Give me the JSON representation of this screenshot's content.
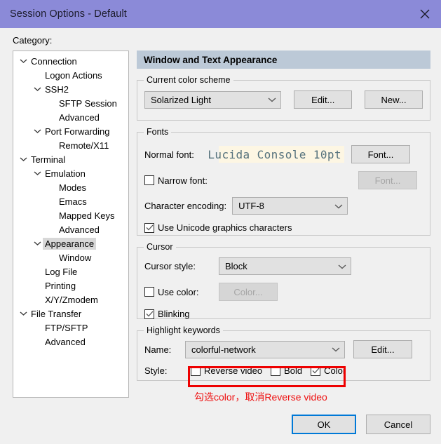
{
  "window": {
    "title": "Session Options - Default",
    "close_icon": "close-icon",
    "titlebar_color": "#8b8ad8"
  },
  "sidebar": {
    "label": "Category:",
    "items": [
      {
        "label": "Connection",
        "level": 0,
        "chevron": true,
        "selected": false
      },
      {
        "label": "Logon Actions",
        "level": 1,
        "chevron": false,
        "selected": false
      },
      {
        "label": "SSH2",
        "level": 1,
        "chevron": true,
        "selected": false
      },
      {
        "label": "SFTP Session",
        "level": 2,
        "chevron": false,
        "selected": false
      },
      {
        "label": "Advanced",
        "level": 2,
        "chevron": false,
        "selected": false
      },
      {
        "label": "Port Forwarding",
        "level": 1,
        "chevron": true,
        "selected": false
      },
      {
        "label": "Remote/X11",
        "level": 2,
        "chevron": false,
        "selected": false
      },
      {
        "label": "Terminal",
        "level": 0,
        "chevron": true,
        "selected": false
      },
      {
        "label": "Emulation",
        "level": 1,
        "chevron": true,
        "selected": false
      },
      {
        "label": "Modes",
        "level": 2,
        "chevron": false,
        "selected": false
      },
      {
        "label": "Emacs",
        "level": 2,
        "chevron": false,
        "selected": false
      },
      {
        "label": "Mapped Keys",
        "level": 2,
        "chevron": false,
        "selected": false
      },
      {
        "label": "Advanced",
        "level": 2,
        "chevron": false,
        "selected": false
      },
      {
        "label": "Appearance",
        "level": 1,
        "chevron": true,
        "selected": true
      },
      {
        "label": "Window",
        "level": 2,
        "chevron": false,
        "selected": false
      },
      {
        "label": "Log File",
        "level": 1,
        "chevron": false,
        "selected": false
      },
      {
        "label": "Printing",
        "level": 1,
        "chevron": false,
        "selected": false
      },
      {
        "label": "X/Y/Zmodem",
        "level": 1,
        "chevron": false,
        "selected": false
      },
      {
        "label": "File Transfer",
        "level": 0,
        "chevron": true,
        "selected": false
      },
      {
        "label": "FTP/SFTP",
        "level": 1,
        "chevron": false,
        "selected": false
      },
      {
        "label": "Advanced",
        "level": 1,
        "chevron": false,
        "selected": false
      }
    ]
  },
  "panel": {
    "header": "Window and Text Appearance",
    "color_scheme": {
      "group_title": "Current color scheme",
      "value": "Solarized Light",
      "edit_label": "Edit...",
      "new_label": "New..."
    },
    "fonts": {
      "group_title": "Fonts",
      "normal_font_label": "Normal font:",
      "normal_font_value": "Lucida Console 10pt",
      "normal_font_button": "Font...",
      "narrow_font_label": "Narrow font:",
      "narrow_font_checked": false,
      "narrow_font_button": "Font...",
      "encoding_label": "Character encoding:",
      "encoding_value": "UTF-8",
      "unicode_label": "Use Unicode graphics characters",
      "unicode_checked": true
    },
    "cursor": {
      "group_title": "Cursor",
      "style_label": "Cursor style:",
      "style_value": "Block",
      "use_color_label": "Use color:",
      "use_color_checked": false,
      "color_button": "Color...",
      "blinking_label": "Blinking",
      "blinking_checked": true
    },
    "highlight": {
      "group_title": "Highlight keywords",
      "name_label": "Name:",
      "name_value": "colorful-network",
      "edit_label": "Edit...",
      "style_label": "Style:",
      "reverse_video_label": "Reverse video",
      "reverse_video_checked": false,
      "bold_label": "Bold",
      "bold_checked": false,
      "color_label": "Color",
      "color_checked": true
    }
  },
  "annotation": {
    "note": "勾选color，取消Reverse video",
    "color": "#ee1111"
  },
  "footer": {
    "ok_label": "OK",
    "cancel_label": "Cancel"
  }
}
